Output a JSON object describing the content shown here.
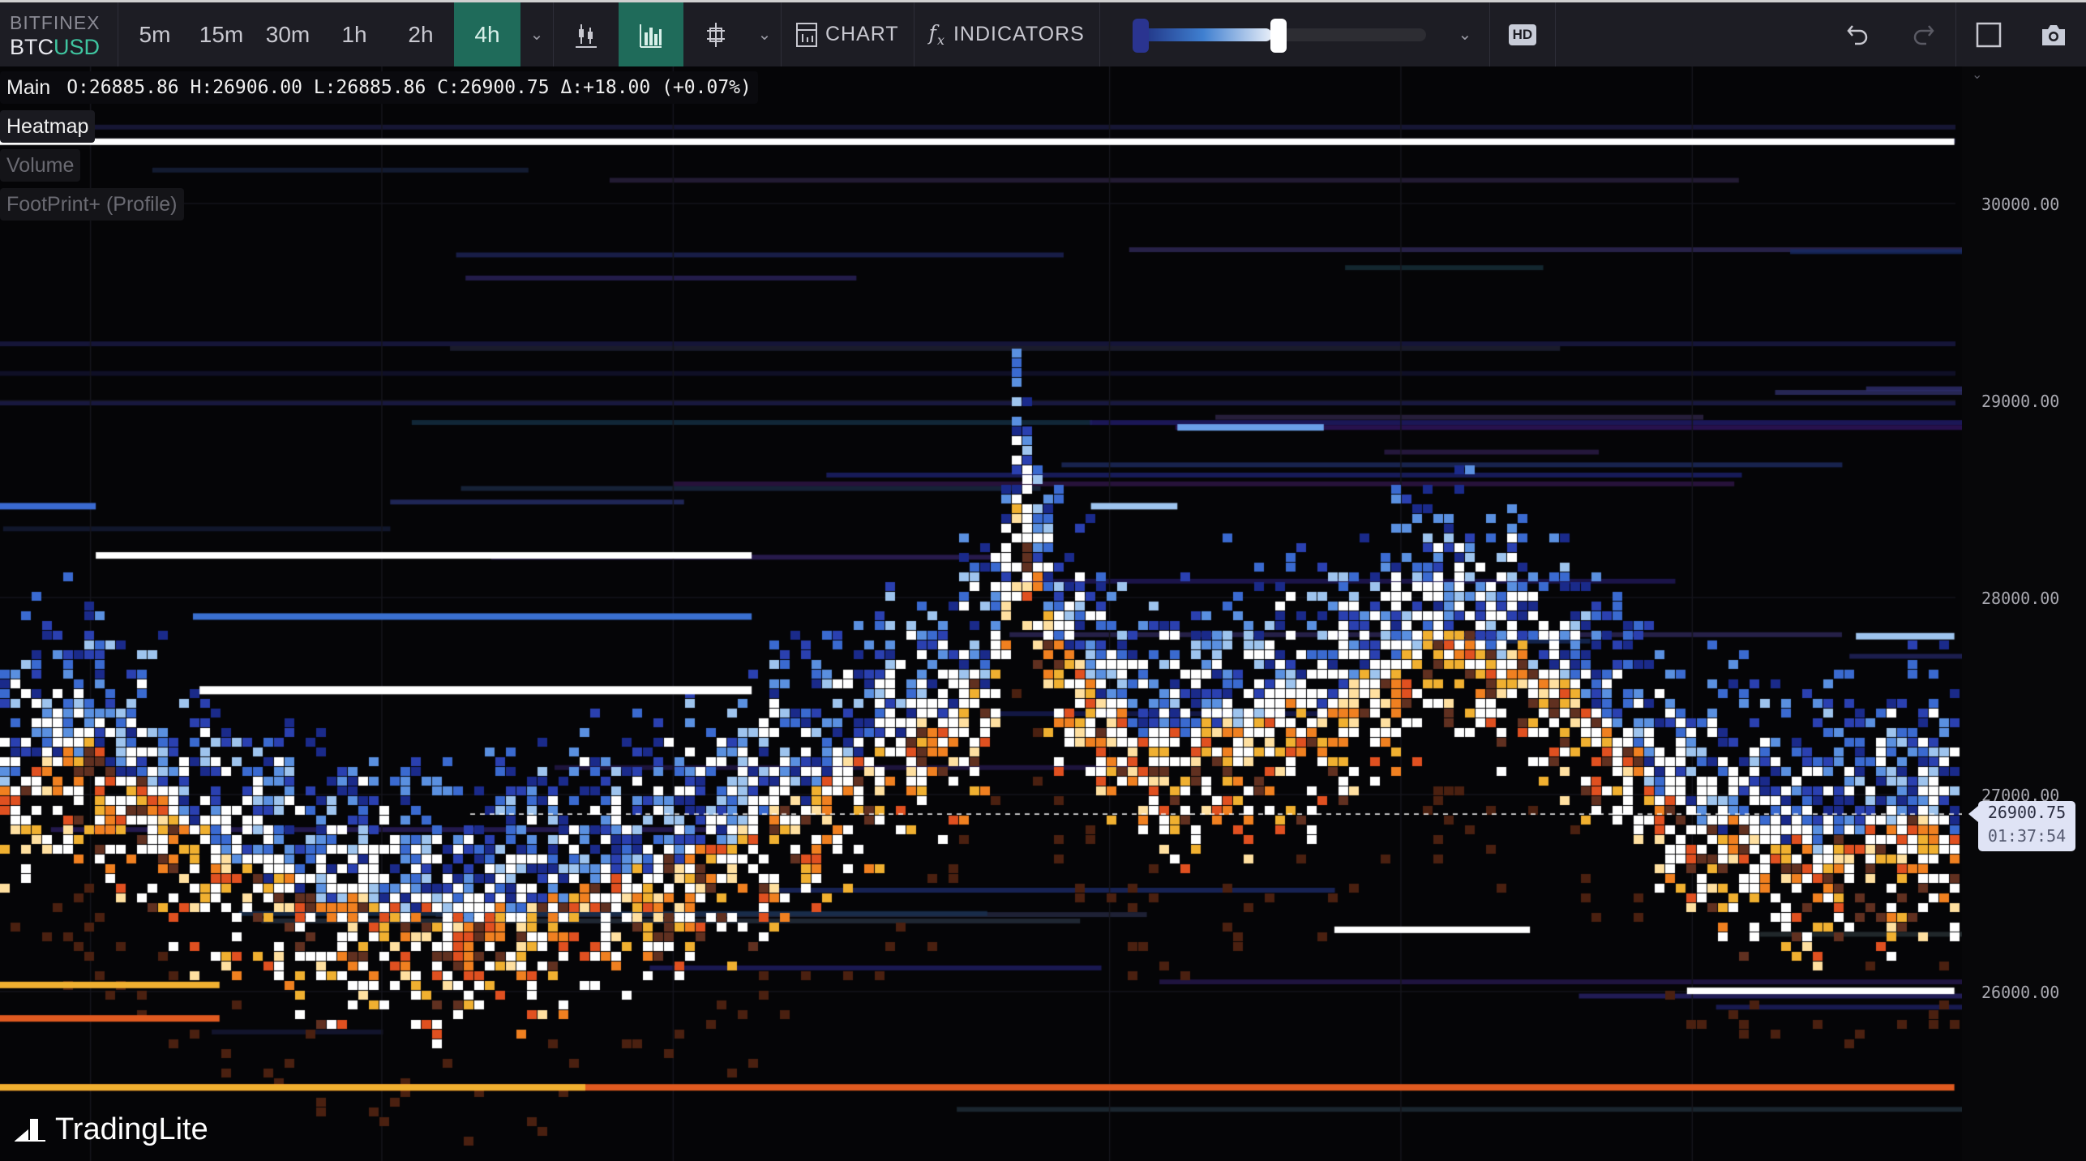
{
  "toolbar": {
    "exchange": "BITFINEX",
    "pair_base": "BTC",
    "pair_quote": "USD",
    "timeframes": [
      "5m",
      "15m",
      "30m",
      "1h",
      "2h",
      "4h"
    ],
    "active_timeframe": "4h",
    "chart_label": "CHART",
    "indicators_label": "INDICATORS",
    "hd_label": "HD",
    "icons": [
      "candlestick-icon",
      "bars-icon",
      "crosshair-icon",
      "undo-icon",
      "redo-icon",
      "layout-icon",
      "camera-icon"
    ]
  },
  "legend": {
    "main": "Main",
    "ohlc": "O:26885.86 H:26906.00 L:26885.86 C:26900.75 Δ:+18.00 (+0.07%)",
    "heatmap": "Heatmap",
    "volume": "Volume",
    "footprint": "FootPrint+ (Profile)"
  },
  "axis": {
    "ticks": [
      "30000.00",
      "29000.00",
      "28000.00",
      "27000.00",
      "26000.00"
    ]
  },
  "price_tag": {
    "price": "26900.75",
    "countdown": "01:37:54"
  },
  "brand": "TradingLite",
  "colors": {
    "accent": "#1f6b5a",
    "quote": "#3fc5a0",
    "bid": "#f0a020",
    "ask": "#3a70d0"
  }
}
